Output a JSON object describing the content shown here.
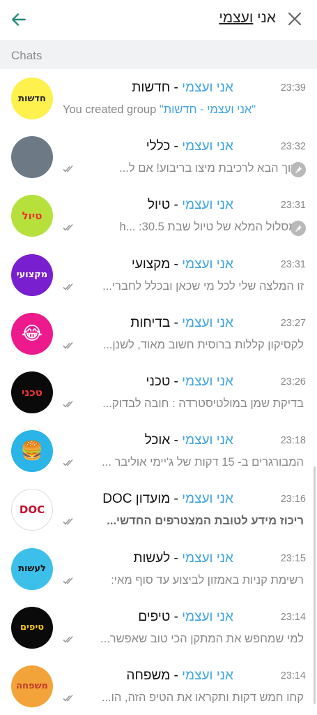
{
  "search": {
    "query_hl": "ועצמי",
    "query_rest": "אני "
  },
  "section": {
    "title": "Chats"
  },
  "colors": {
    "accent": "#3fa4e0",
    "back_arrow": "#1f8a7a"
  },
  "chats": [
    {
      "name_hl": "אני ועצמי",
      "name_rest": " - חדשות",
      "time": "23:39",
      "message_ltr": true,
      "message_prefix": "You created group ",
      "message_hl": "\"אני ועצמי - חדשות\"",
      "avatar_bg": "#fff14d",
      "avatar_text": "חדשות",
      "avatar_fg": "#222",
      "pinned": false,
      "ticks": false
    },
    {
      "name_hl": "אני ועצמי",
      "name_rest": " - כללי",
      "time": "23:32",
      "message": "ברוך הבא לרכיבת מיצו בריבוע! אם ל...",
      "avatar_bg": "#6d7a86",
      "avatar_text": "",
      "avatar_fg": "#fff",
      "pinned": true,
      "ticks": true
    },
    {
      "name_hl": "אני ועצמי",
      "name_rest": " - טיול",
      "time": "23:31",
      "message": "המסלול המלא של טיול שבת 30.5:  ...h",
      "avatar_bg": "#b6e13d",
      "avatar_text": "טיול",
      "avatar_fg": "#e8322b",
      "pinned": true,
      "ticks": true
    },
    {
      "name_hl": "אני ועצמי",
      "name_rest": " - מקצועי",
      "time": "23:31",
      "message": "זו המלצה שלי לכל מי שכאן ובכלל לחברי...",
      "avatar_bg": "#7a1fd0",
      "avatar_text": "מקצועי",
      "avatar_fg": "#fff",
      "pinned": false,
      "ticks": true
    },
    {
      "name_hl": "אני ועצמי",
      "name_rest": " - בדיחות",
      "time": "23:27",
      "message": "לקסיקון קללות ברוסית  חשוב מאוד, לשנן...",
      "avatar_bg": "#ec1a8c",
      "avatar_text": "😂",
      "avatar_fg": "#fff",
      "pinned": false,
      "ticks": true
    },
    {
      "name_hl": "אני ועצמי",
      "name_rest": " - טכני",
      "time": "23:26",
      "message": "בדיקת שמן במולטיסטרדה :  חובה לבדוק...",
      "avatar_bg": "#0a0a0a",
      "avatar_text": "טכני",
      "avatar_fg": "#e33",
      "pinned": false,
      "ticks": true
    },
    {
      "name_hl": "אני ועצמי",
      "name_rest": " - אוכל",
      "time": "23:18",
      "message": "המבורגרים ב- 15 דקות של ג'יימי אוליבר  ...",
      "avatar_bg": "#2ab4e8",
      "avatar_text": "🍔",
      "avatar_fg": "#fff",
      "pinned": false,
      "ticks": true
    },
    {
      "name_hl": "אני ועצמי",
      "name_rest": " - מועדון DOC",
      "time": "23:16",
      "message_bold": "ריכוז מידע לטובת המצטרפים החדשי...",
      "avatar_bg": "#ffffff",
      "avatar_text": "DOC",
      "avatar_fg": "#c8102e",
      "pinned": false,
      "ticks": true
    },
    {
      "name_hl": "אני ועצמי",
      "name_rest": " - לעשות",
      "time": "23:15",
      "message": "רשימת קניות באמזון לביצוע עד סוף מאי:",
      "avatar_bg": "#3cc0ea",
      "avatar_text": "לעשות",
      "avatar_fg": "#111",
      "pinned": false,
      "ticks": true
    },
    {
      "name_hl": "אני ועצמי",
      "name_rest": " - טיפים",
      "time": "23:14",
      "message": "למי שמחפש את המתקן הכי טוב שאפשר...",
      "avatar_bg": "#0a0a0a",
      "avatar_text": "טיפים",
      "avatar_fg": "#f5c518",
      "pinned": false,
      "ticks": true
    },
    {
      "name_hl": "אני ועצמי",
      "name_rest": " - משפחה",
      "time": "23:14",
      "message": "קחו חמש דקות ותקראו את הטיפ הזה, הו...",
      "avatar_bg": "#f2a43a",
      "avatar_text": "משפחה",
      "avatar_fg": "#c0392b",
      "pinned": false,
      "ticks": true
    }
  ]
}
